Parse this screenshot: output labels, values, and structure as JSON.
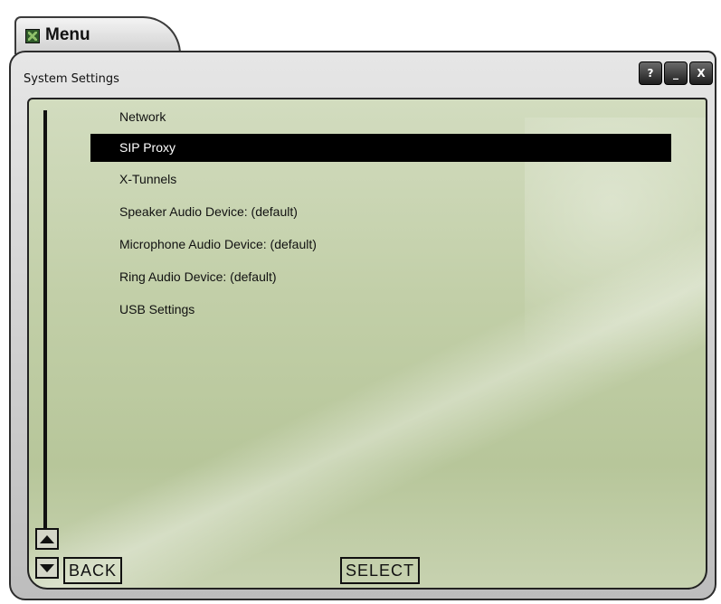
{
  "window": {
    "tab_title": "Menu",
    "panel_title": "System Settings",
    "buttons": {
      "help": "?",
      "minimize": "_",
      "close": "X"
    }
  },
  "menu": {
    "selected_index": 1,
    "items": [
      {
        "label": "Network"
      },
      {
        "label": "SIP Proxy"
      },
      {
        "label": "X-Tunnels"
      },
      {
        "label": "Speaker Audio Device: (default)"
      },
      {
        "label": "Microphone Audio Device: (default)"
      },
      {
        "label": "Ring Audio Device: (default)"
      },
      {
        "label": "USB Settings"
      }
    ]
  },
  "footer": {
    "back_label": "BACK",
    "select_label": "SELECT"
  },
  "icons": {
    "tab": "menu-grid-icon",
    "scroll_up": "arrow-up-icon",
    "scroll_down": "arrow-down-icon"
  }
}
